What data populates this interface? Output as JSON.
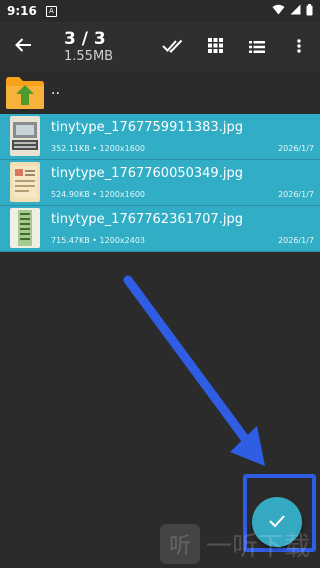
{
  "status_bar": {
    "time": "9:16",
    "notification_badge": "A"
  },
  "toolbar": {
    "selection_count": "3 / 3",
    "total_size": "1.55MB"
  },
  "parent_row": {
    "label": ".."
  },
  "files": [
    {
      "name": "tinytype_1767759911383.jpg",
      "size": "352.11KB",
      "dimensions": "1200x1600",
      "date": "2026/1/7",
      "selected": true
    },
    {
      "name": "tinytype_1767760050349.jpg",
      "size": "524.90KB",
      "dimensions": "1200x1600",
      "date": "2026/1/7",
      "selected": true
    },
    {
      "name": "tinytype_1767762361707.jpg",
      "size": "715.47KB",
      "dimensions": "1200x2403",
      "date": "2026/1/7",
      "selected": true
    }
  ],
  "colors": {
    "selected_row": "#31aec6",
    "fab": "#35a9c2",
    "annotation": "#2f5de3",
    "background": "#2b2b2b"
  },
  "watermark": {
    "text": "一听下载",
    "logo_char": "听"
  }
}
